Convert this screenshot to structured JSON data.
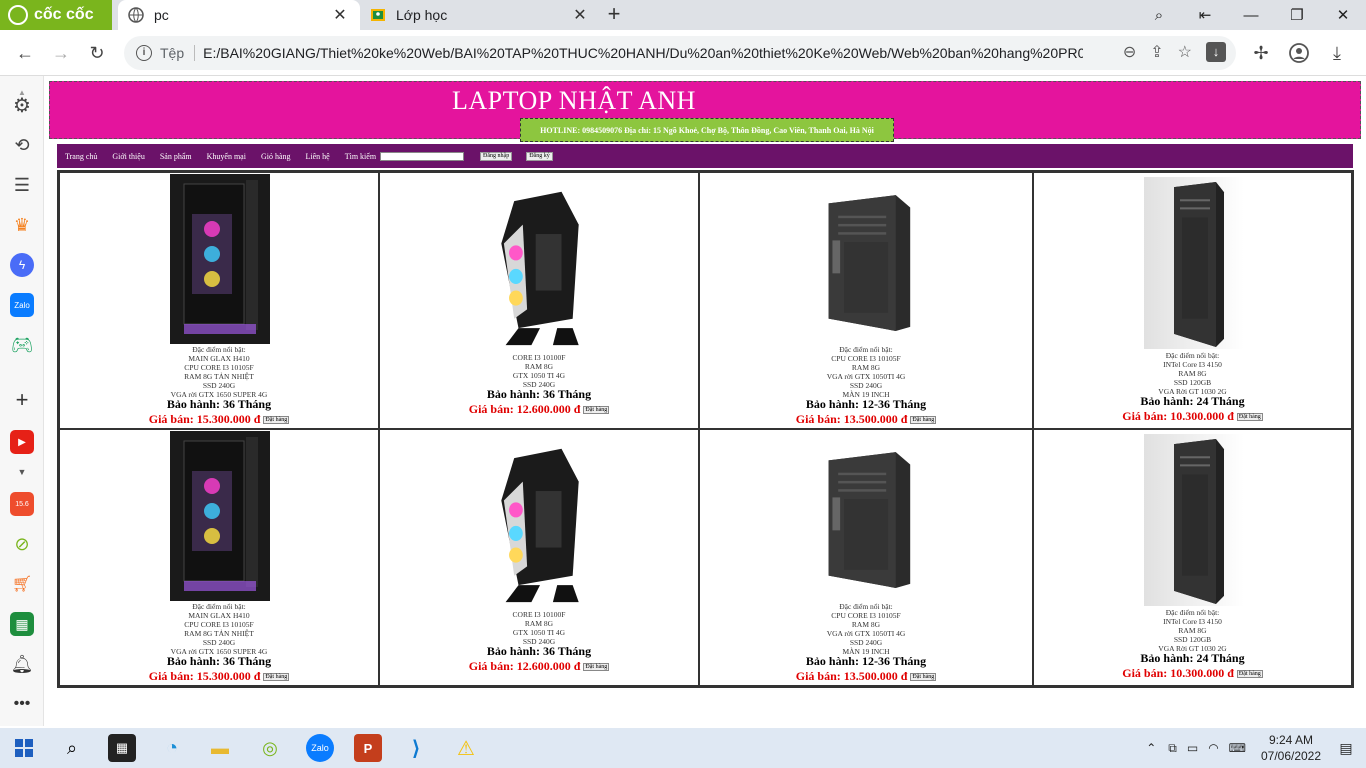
{
  "browser": {
    "brand_label": "cốc cốc",
    "tabs": [
      {
        "title": "pc",
        "active": true
      },
      {
        "title": "Lớp học",
        "active": false
      }
    ],
    "address": {
      "scheme_label": "Tệp",
      "url": "E:/BAI%20GIANG/Thiet%20ke%20Web/BAI%20TAP%20THUC%20HANH/Du%20an%20thiet%20Ke%20Web/Web%20ban%20hang%20PR01_02..."
    }
  },
  "site": {
    "title": "LAPTOP NHẬT ANH",
    "hotline": "HOTLINE: 0984509076 Địa chỉ: 15 Ngõ Khoẻ, Chợ Bộ, Thôn Đồng, Cao Viên, Thanh Oai, Hà Nội"
  },
  "nav": {
    "items": [
      "Trang chủ",
      "Giới thiệu",
      "Sản phẩm",
      "Khuyến mại",
      "Giỏ hàng",
      "Liên hệ"
    ],
    "search_label": "Tìm kiếm",
    "login": "Đăng nhập",
    "register": "Đăng ký"
  },
  "products": [
    {
      "style": "rgb-tall",
      "desc": [
        "Đặc điểm nổi bật:",
        "MAIN GLAX H410",
        "CPU CORE I3 10105F",
        "RAM 8G TẢN NHIỆT",
        "SSD 240G",
        "VGA rời GTX 1650 SUPER 4G"
      ],
      "warranty": "Bảo hành: 36 Tháng",
      "price": "Giá bán: 15.300.000 đ"
    },
    {
      "style": "rgb-angled",
      "desc": [
        "CORE I3 10100F",
        "RAM 8G",
        "GTX 1050 TI 4G",
        "SSD 240G"
      ],
      "warranty": "Bảo hành: 36 Tháng",
      "price": "Giá bán: 12.600.000 đ"
    },
    {
      "style": "black-box",
      "desc": [
        "Đặc điểm nổi bật:",
        "CPU CORE I3 10105F",
        "RAM 8G",
        "VGA rời GTX 1050TI 4G",
        "SSD 240G",
        "MÀN 19 INCH"
      ],
      "warranty": "Bảo hành: 12-36 Tháng",
      "price": "Giá bán: 13.500.000 đ"
    },
    {
      "style": "black-slim",
      "desc": [
        "Đặc điểm nổi bật:",
        "INTel Core I3 4150",
        "RAM 8G",
        "SSD 120GB",
        "VGA Rời GT 1030 2G"
      ],
      "warranty": "Bảo hành: 24 Tháng",
      "price": "Giá bán: 10.300.000 đ"
    }
  ],
  "order_label": "Đặt hàng",
  "taskbar": {
    "time": "9:24 AM",
    "date": "07/06/2022"
  },
  "colors": {
    "header_bg": "#e4149d",
    "hotline_bg": "#8dc63f",
    "nav_bg": "#6b1269",
    "price": "#e00000"
  }
}
